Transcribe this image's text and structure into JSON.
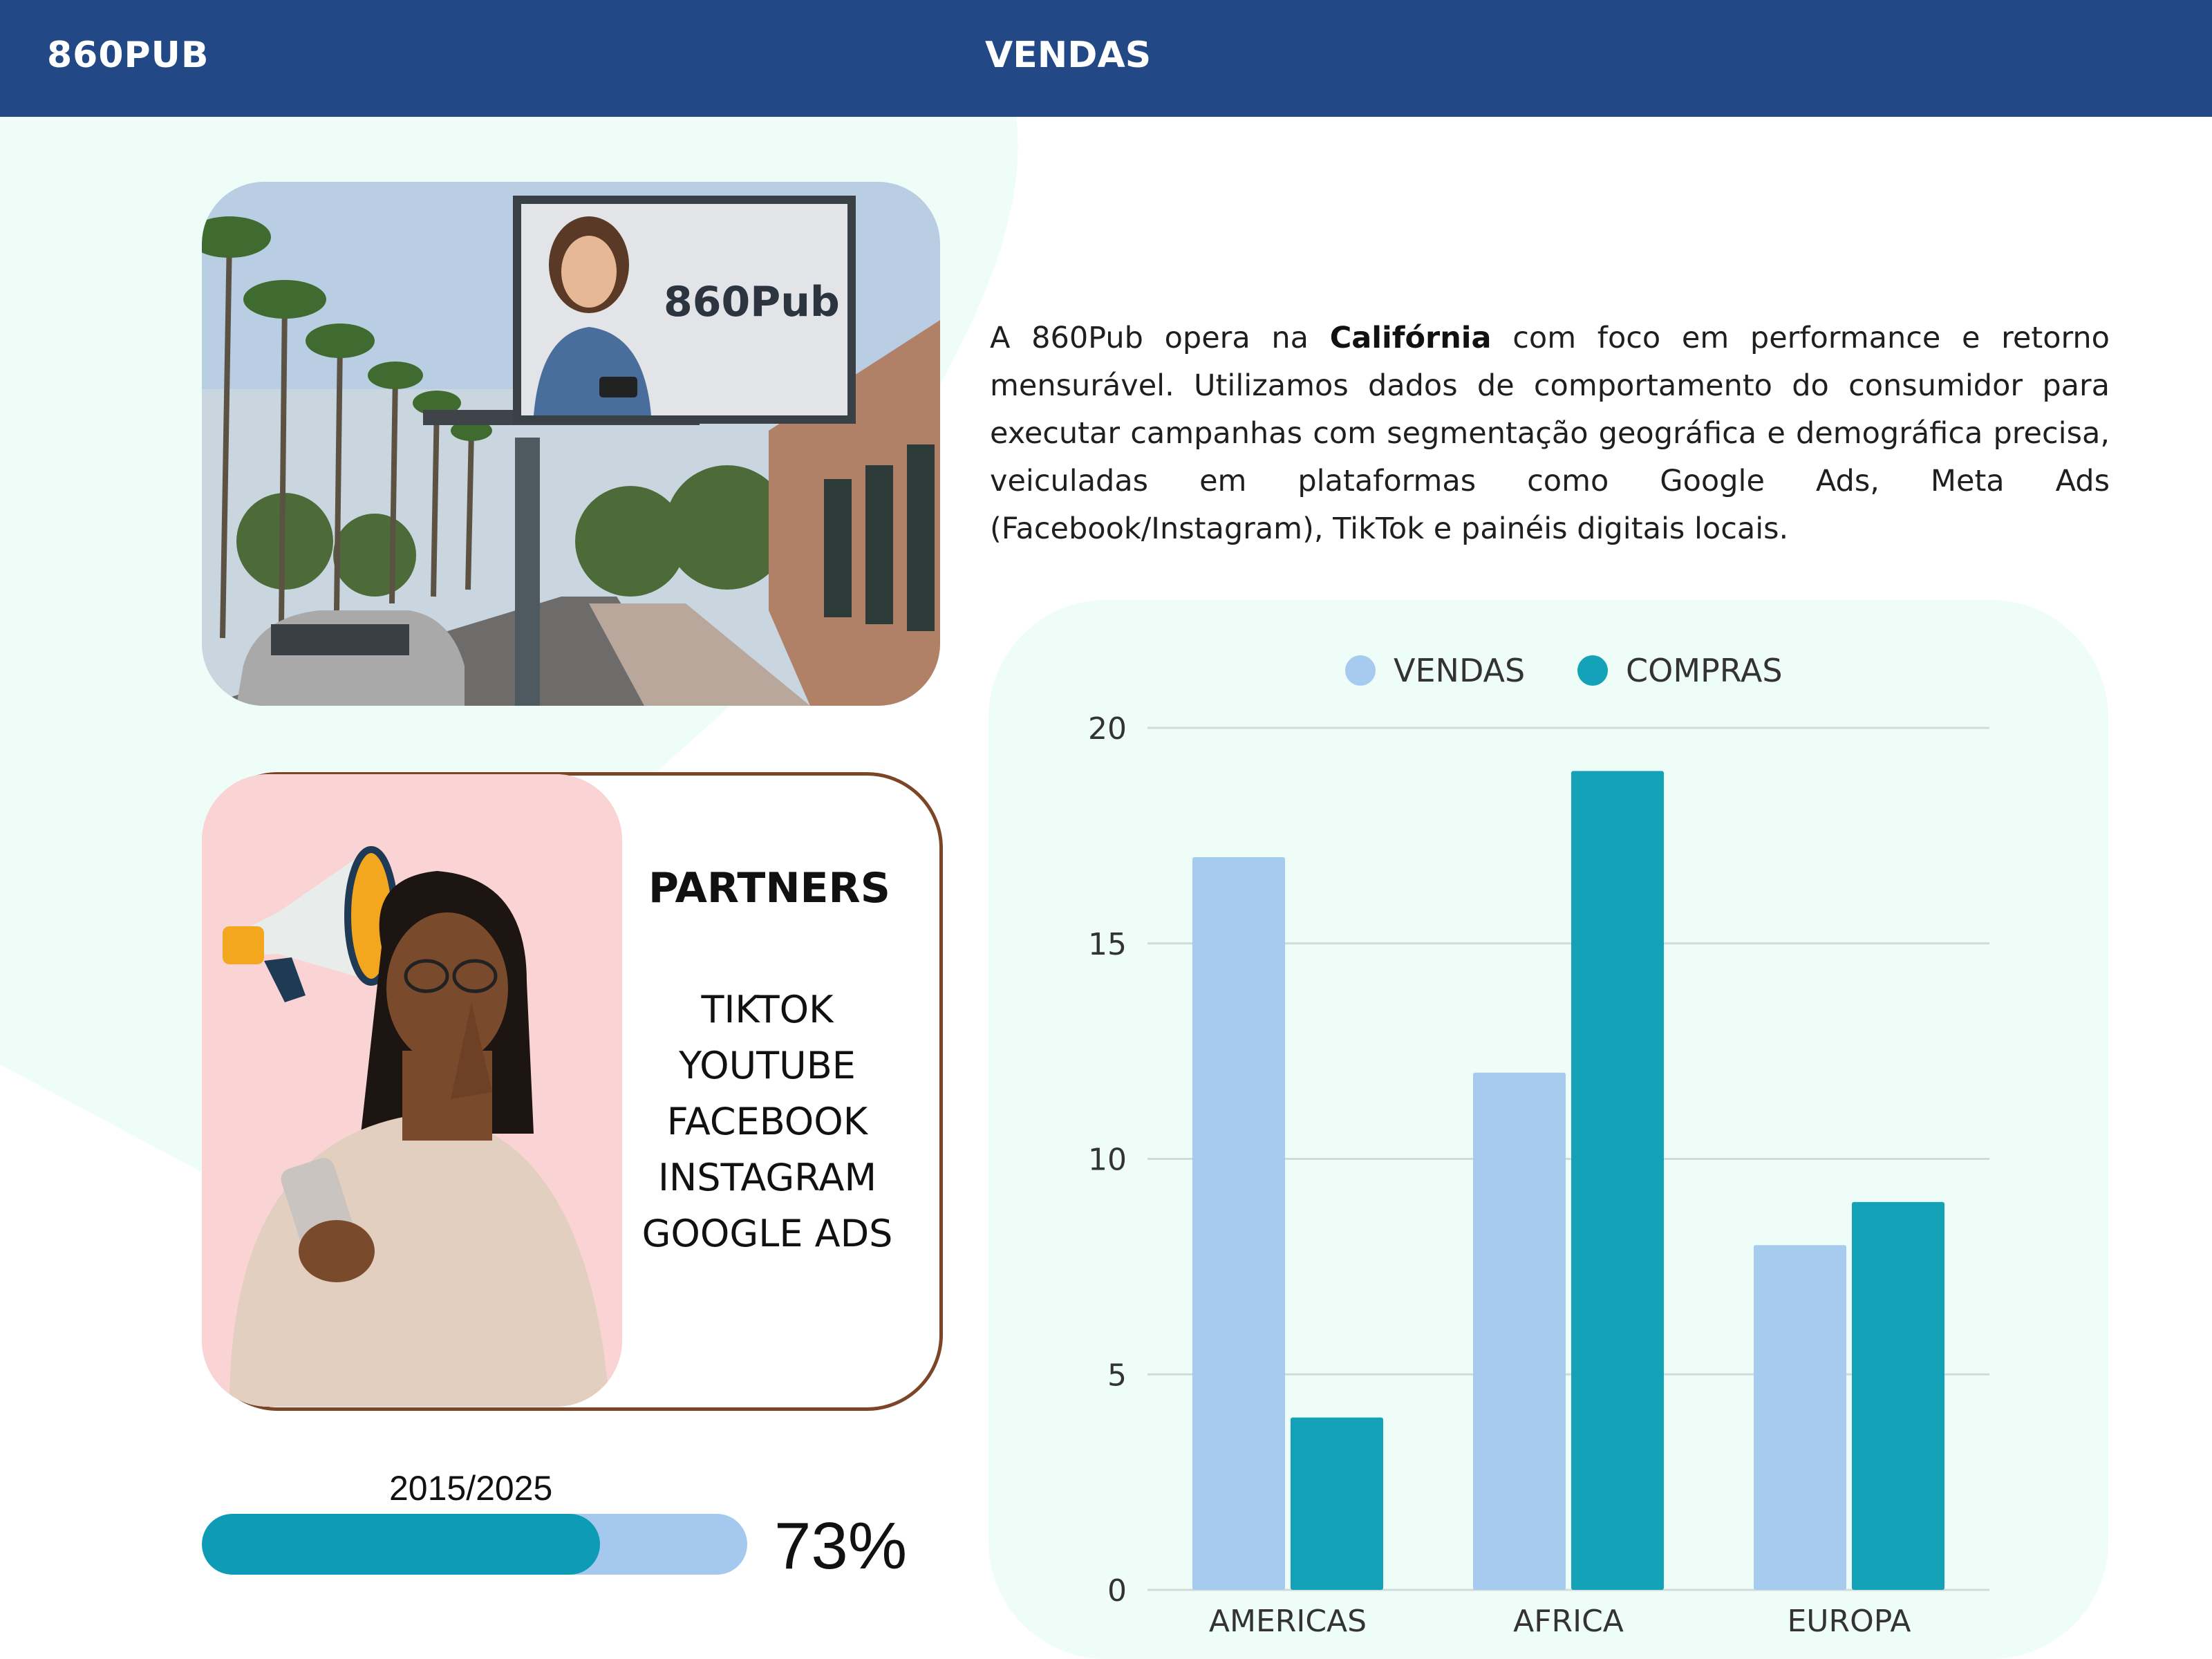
{
  "header": {
    "brand": "860PUB",
    "title": "VENDAS"
  },
  "photo": {
    "billboard_text": "860Pub"
  },
  "description": {
    "part1": "A 860Pub opera na ",
    "bold": "Califórnia",
    "part2": " com foco em performance e retorno mensurável. Utilizamos dados de comportamento do consumidor para executar campanhas com segmentação geográfica e demográfica precisa, veiculadas em plataformas como Google Ads, Meta Ads (Facebook/Instagram), TikTok e painéis digitais locais."
  },
  "partners": {
    "title": "PARTNERS",
    "items": [
      "TIKTOK",
      "YOUTUBE",
      "FACEBOOK",
      "INSTAGRAM",
      "GOOGLE ADS"
    ]
  },
  "progress": {
    "period": "2015/2025",
    "percent_label": "73%",
    "value": 0.73
  },
  "colors": {
    "header": "#224886",
    "vendas": "#a7cbef",
    "compras": "#14a2b8",
    "panel": "#effdf9",
    "progress_fill": "#0d9bb6",
    "progress_track": "#a4c8ee"
  },
  "chart_data": {
    "type": "bar",
    "categories": [
      "AMERICAS",
      "AFRICA",
      "EUROPA"
    ],
    "series": [
      {
        "name": "VENDAS",
        "values": [
          17,
          12,
          8
        ]
      },
      {
        "name": "COMPRAS",
        "values": [
          4,
          19,
          9
        ]
      }
    ],
    "ylim": [
      0,
      20
    ],
    "yticks": [
      0,
      5,
      10,
      15,
      20
    ],
    "grid": true,
    "legend": "top-center"
  }
}
